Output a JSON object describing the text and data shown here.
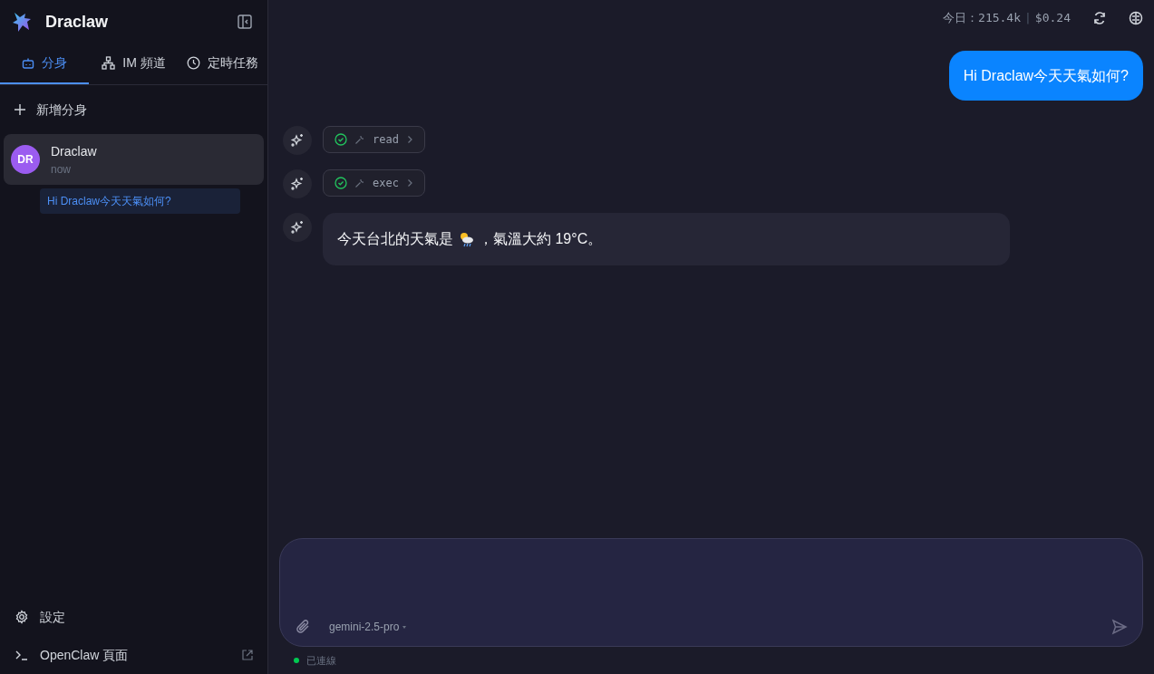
{
  "app": {
    "title": "Draclaw"
  },
  "tabs": [
    {
      "label": "分身",
      "kind": "bot",
      "selected": true
    },
    {
      "label": "IM 頻道",
      "kind": "network",
      "selected": false
    },
    {
      "label": "定時任務",
      "kind": "clock",
      "selected": false
    }
  ],
  "add_button": "新增分身",
  "sessions": [
    {
      "initials": "DR",
      "name": "Draclaw",
      "time": "now",
      "selected": true,
      "preview": "Hi Draclaw今天天氣如何?"
    }
  ],
  "footer": [
    {
      "label": "設定",
      "kind": "settings"
    },
    {
      "label": "OpenClaw 頁面",
      "kind": "external"
    }
  ],
  "usage": {
    "today": "今日：215.4k",
    "separator": "|",
    "cost": "$0.24"
  },
  "messages": [
    {
      "kind": "user",
      "text": "Hi Draclaw今天天氣如何?"
    },
    {
      "kind": "tool",
      "name": "read",
      "done": true
    },
    {
      "kind": "tool",
      "name": "exec",
      "done": true
    },
    {
      "kind": "assistant",
      "before": "今天台北的天氣是",
      "after": "，氣溫大約 19°C。"
    }
  ],
  "composer": {
    "model": "gemini-2.5-pro",
    "connection": "已連線",
    "connected": true
  }
}
